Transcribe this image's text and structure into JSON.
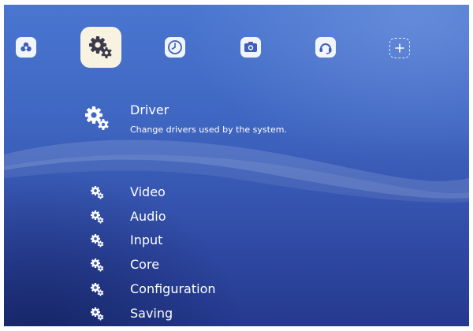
{
  "tabs": [
    {
      "name": "main-menu",
      "icon": "retroarch-logo-icon"
    },
    {
      "name": "settings",
      "icon": "gears-icon",
      "active": true
    },
    {
      "name": "history",
      "icon": "clock-icon"
    },
    {
      "name": "images",
      "icon": "camera-icon"
    },
    {
      "name": "netplay",
      "icon": "headset-icon"
    },
    {
      "name": "add",
      "icon": "add-icon"
    }
  ],
  "header": {
    "title": "Driver",
    "subtitle": "Change drivers used by the system.",
    "icon": "gears-icon"
  },
  "menu": {
    "items": [
      {
        "label": "Video",
        "icon": "gears-icon"
      },
      {
        "label": "Audio",
        "icon": "gears-icon"
      },
      {
        "label": "Input",
        "icon": "gears-icon"
      },
      {
        "label": "Core",
        "icon": "gears-icon"
      },
      {
        "label": "Configuration",
        "icon": "gears-icon"
      },
      {
        "label": "Saving",
        "icon": "gears-icon"
      }
    ]
  },
  "colors": {
    "background": "#3f67c2",
    "active_tab": "#f8f2e0",
    "text": "#ffffff"
  }
}
